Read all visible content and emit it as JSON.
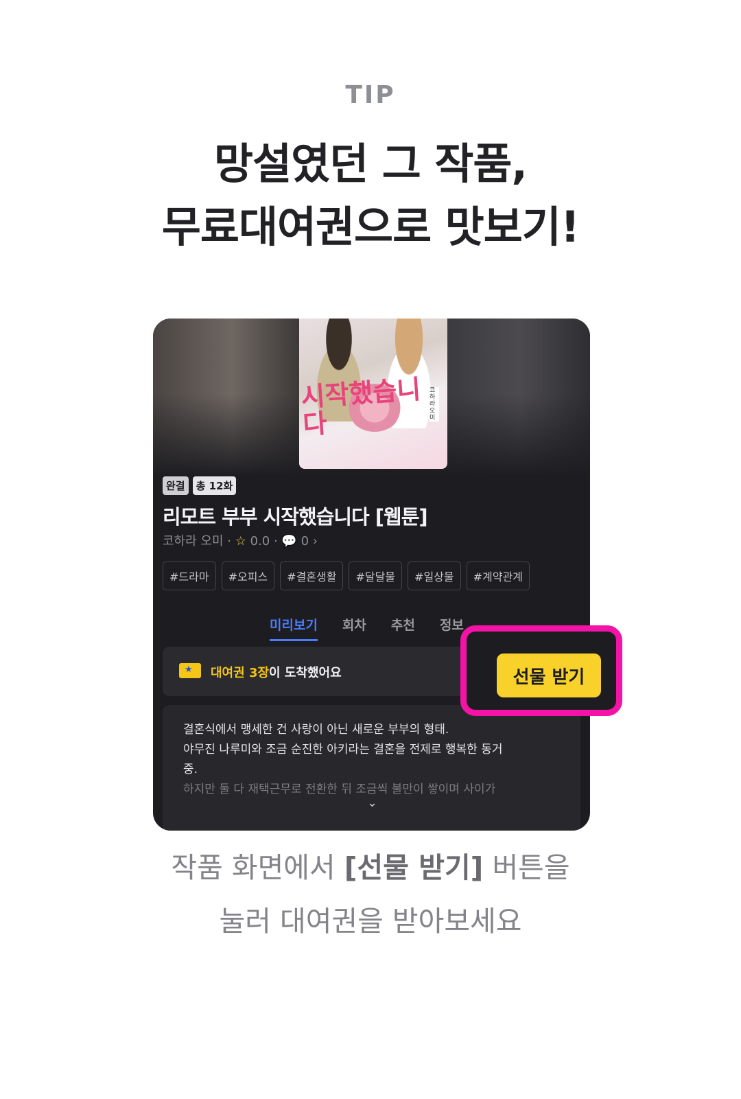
{
  "tip_label": "TIP",
  "headline": {
    "line1": "망설였던 그 작품,",
    "line2": "무료대여권으로 맛보기!"
  },
  "work": {
    "cover_title": "시작했습니다",
    "cover_author": "코하라 오미",
    "badge_complete": "완결",
    "badge_total": "총 12화",
    "title": "리모트 부부 시작했습니다 [웹툰]",
    "author": "코하라 오미",
    "rating": "0.0",
    "comments": "0",
    "tags": [
      "#드라마",
      "#오피스",
      "#결혼생활",
      "#달달물",
      "#일상물",
      "#계약관계"
    ],
    "tabs": [
      "미리보기",
      "회차",
      "추천",
      "정보"
    ],
    "active_tab": "미리보기"
  },
  "notice": {
    "highlight": "대여권 3장",
    "rest": "이 도착했어요",
    "ticket_icon": "★"
  },
  "gift_button": "선물 받기",
  "synopsis": {
    "line1": "결혼식에서 맹세한 건 사랑이 아닌 새로운 부부의 형태.",
    "line2": "야무진 나루미와 조금 순진한 아키라는 결혼을 전제로 행복한 동거",
    "line3": "중.",
    "line4": "하지만 둘 다 재택근무로 전환한 뒤 조금씩 불만이 쌓이며 사이가"
  },
  "caption": {
    "line1_before": "작품 화면에서 ",
    "line1_bold": "[선물 받기]",
    "line1_after": " 버튼을",
    "line2": "눌러 대여권을 받아보세요"
  },
  "colors": {
    "accent_blue": "#4a7cff",
    "highlight_pink": "#f413a7",
    "button_yellow": "#f8d22a"
  }
}
